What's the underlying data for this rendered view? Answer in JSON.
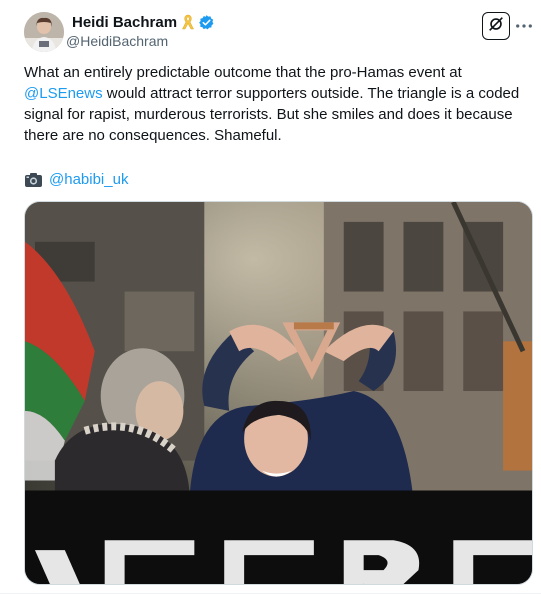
{
  "author": {
    "display_name": "Heidi Bachram",
    "handle": "@HeidiBachram"
  },
  "tweet": {
    "text_before_mention": "What an entirely predictable outcome that the pro-Hamas event at ",
    "mention": "@LSEnews",
    "text_after_mention": " would attract terror supporters outside. The triangle is a coded signal for rapist, murderous terrorists. But she smiles and does it because there are no consequences. Shameful.",
    "credit_mention": "@habibi_uk"
  },
  "icons": {
    "ribbon": "yellow-ribbon-icon",
    "verified": "verified-badge-icon",
    "grok": "grok-icon",
    "more": "more-icon",
    "camera": "camera-icon"
  },
  "colors": {
    "link": "#1d9bf0",
    "text": "#0f1419",
    "secondary": "#536471",
    "ribbon": "#f5c542"
  }
}
